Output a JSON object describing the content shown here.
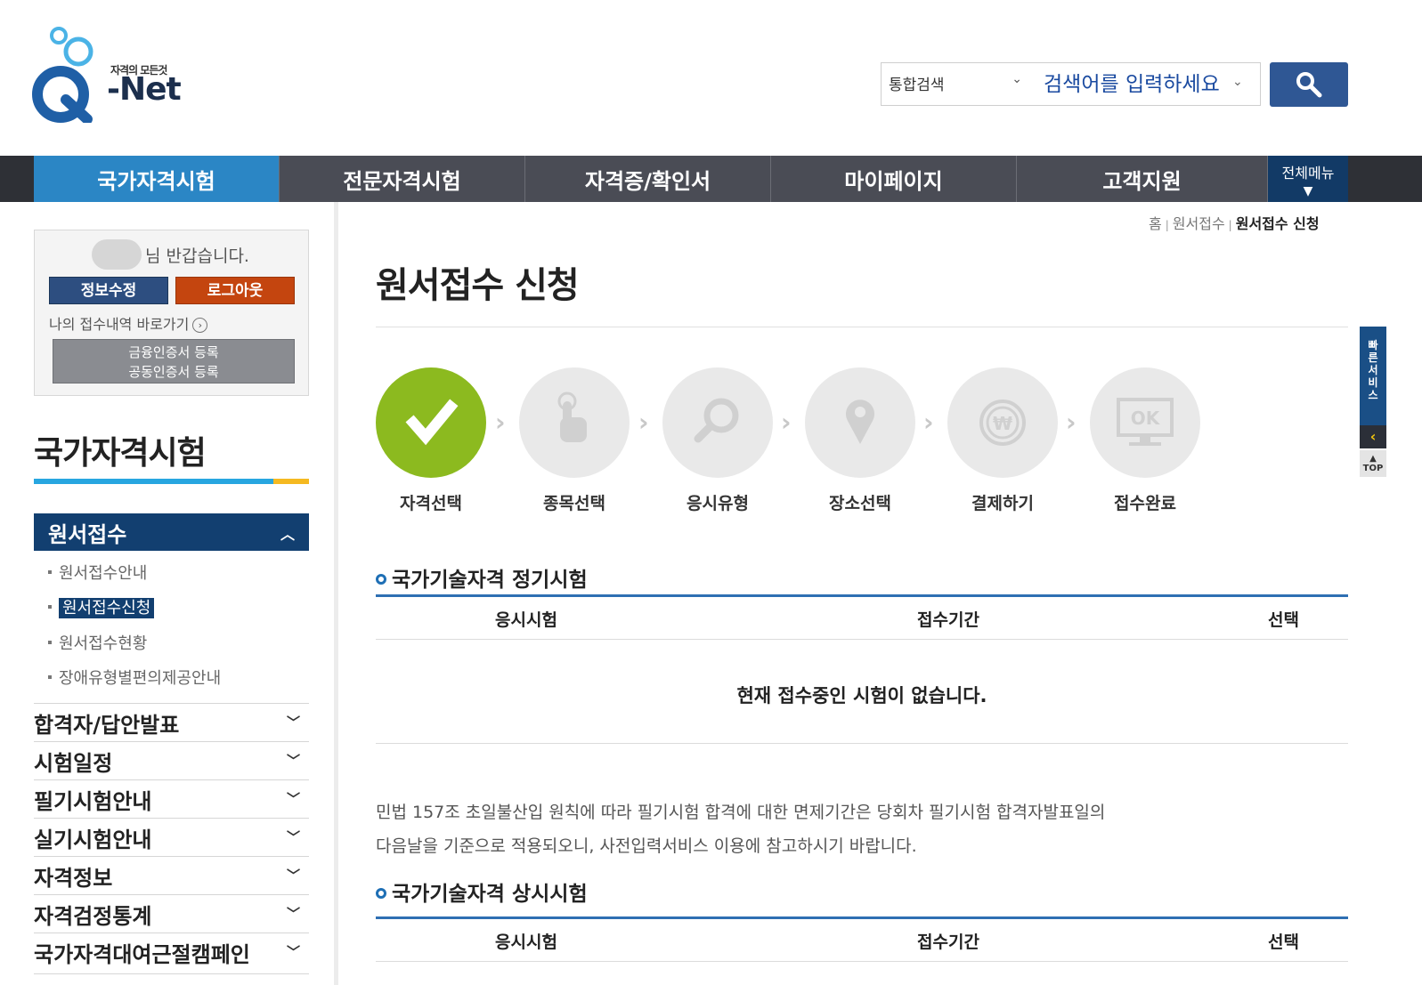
{
  "header": {
    "logo_tagline": "자격의 모든것",
    "logo_text": "-Net",
    "search_scope": "통합검색",
    "search_placeholder": "검색어를 입력하세요"
  },
  "gnb": {
    "items": [
      "국가자격시험",
      "전문자격시험",
      "자격증/확인서",
      "마이페이지",
      "고객지원"
    ],
    "active_index": 0,
    "all_menu": "전체메뉴"
  },
  "login": {
    "greeting": "님 반갑습니다.",
    "edit_button": "정보수정",
    "logout_button": "로그아웃",
    "my_link": "나의 접수내역 바로가기",
    "cert_link_1": "금융인증서 등록",
    "cert_link_2": "공동인증서 등록"
  },
  "sidebar": {
    "title": "국가자격시험",
    "open_menu": "원서접수",
    "sub_items": [
      "원서접수안내",
      "원서접수신청",
      "원서접수현황",
      "장애유형별편의제공안내"
    ],
    "active_sub": 1,
    "menu_rows": [
      "합격자/답안발표",
      "시험일정",
      "필기시험안내",
      "실기시험안내",
      "자격정보",
      "자격검정통계",
      "국가자격대여근절캠페인"
    ]
  },
  "breadcrumb": {
    "home": "홈",
    "level1": "원서접수",
    "current": "원서접수 신청"
  },
  "page_title": "원서접수 신청",
  "steps": [
    "자격선택",
    "종목선택",
    "응시유형",
    "장소선택",
    "결제하기",
    "접수완료"
  ],
  "steps_completed": 1,
  "section1": {
    "title": "국가기술자격 정기시험",
    "col_exam": "응시시험",
    "col_period": "접수기간",
    "col_select": "선택",
    "empty_message": "현재 접수중인 시험이 없습니다."
  },
  "notice_line1": "민법 157조 초일불산입 원칙에 따라 필기시험 합격에 대한 면제기간은 당회차 필기시험 합격자발표일의",
  "notice_line2": "다음날을 기준으로 적용되오니, 사전입력서비스 이용에 참고하시기 바랍니다.",
  "section2": {
    "title": "국가기술자격 상시시험",
    "col_exam": "응시시험",
    "col_period": "접수기간",
    "col_select": "선택"
  },
  "quick": {
    "label": "빠른서비스",
    "top": "TOP"
  },
  "colors": {
    "gnb_bg": "#4a4c55",
    "gnb_active": "#2b86c5",
    "navy": "#123f70",
    "step_done": "#8cba1f",
    "logout": "#c4450f",
    "table_accent": "#2e6fb3"
  },
  "icons": [
    "search-icon",
    "check-icon",
    "finger-icon",
    "magnifier-icon",
    "location-pin-icon",
    "won-coin-icon",
    "ok-monitor-icon"
  ]
}
